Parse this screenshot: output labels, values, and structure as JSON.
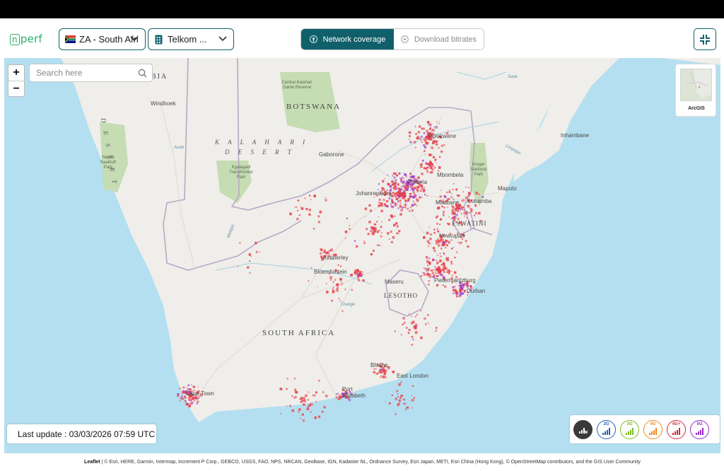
{
  "app": {
    "logo_prefix": "n",
    "logo_suffix": "perf"
  },
  "header": {
    "country_label": "ZA - South Afri",
    "operator_label": "Telkom ...",
    "tabs": [
      {
        "label": "Network coverage",
        "active": true
      },
      {
        "label": "Download bitrates",
        "active": false
      }
    ]
  },
  "map": {
    "search_placeholder": "Search here",
    "zoom_in": "+",
    "zoom_out": "−",
    "basemap_label": "ArcGIS",
    "last_update": "Last update : 03/03/2026 07:59 UTC",
    "labels": {
      "namibia_partial": "BIA",
      "windhoek": "Windhoek",
      "botswana": "BOTSWANA",
      "kalahari_1": "K A L A H A R I",
      "kalahari_2": "D E S E R T",
      "desert_vertical": "D E S E R T",
      "gaborone": "Gaborone",
      "polokwane": "Polokwane",
      "inhambane": "Inhambane",
      "pretoria": "Pretoria",
      "johannesburg": "Johannesburg",
      "mbombela": "Mbombela",
      "maputo": "Maputo",
      "mbabane": "Mbabane",
      "lobamba": "Lobamba",
      "eswatini": "ESWATINI",
      "newcastle": "Newcastle",
      "kimberley": "Kimberley",
      "bloemfontein": "Bloemfontein",
      "maseru": "Maseru",
      "lesotho": "LESOTHO",
      "pietermaritzburg": "Pietermaritzburg",
      "durban": "Durban",
      "south_africa": "SOUTH AFRICA",
      "bhisho": "Bhisho",
      "east_london": "East London",
      "port_elizabeth_1": "Port",
      "port_elizabeth_2": "Elizabeth",
      "cape_town": "Cape Town",
      "central_kalahari": "Central Kalahari Game Reserve",
      "kgalagadi": "Kgalagadi Transfrontier Park",
      "namib_naukluft": "Namib Naukluft Park",
      "kruger": "Kruger National Park",
      "river_auob": "Auob",
      "river_molopo": "Molopo",
      "river_orange": "Orange",
      "river_save": "Save",
      "river_limpopo": "Limpopo"
    }
  },
  "legend": [
    {
      "label": "",
      "color": "#3a3a3a",
      "name": "no-signal"
    },
    {
      "label": "2G",
      "color": "#1f5fb3",
      "name": "2g"
    },
    {
      "label": "3G",
      "color": "#7dbb24",
      "name": "3g"
    },
    {
      "label": "4G",
      "color": "#f08a1c",
      "name": "4g"
    },
    {
      "label": "4G+",
      "color": "#d5273b",
      "name": "4g-plus"
    },
    {
      "label": "5G",
      "color": "#9b2bc5",
      "name": "5g"
    }
  ],
  "attribution": {
    "leaflet": "Leaflet",
    "text": "| © Esri, HERE, Garmin, Intermap, increment P Corp., GEBCO, USGS, FAO, NPS, NRCAN, GeoBase, IGN, Kadaster NL, Ordnance Survey, Esri Japan, METI, Esri China (Hong Kong), © OpenStreetMap contributors, and the GIS User Community"
  },
  "colors": {
    "brand_green": "#2eae6b",
    "accent_teal": "#10606b",
    "ocean": "#b4dff0",
    "land": "#efeeea",
    "coverage_red": "#e8414b",
    "coverage_purple": "#9b44d6"
  }
}
